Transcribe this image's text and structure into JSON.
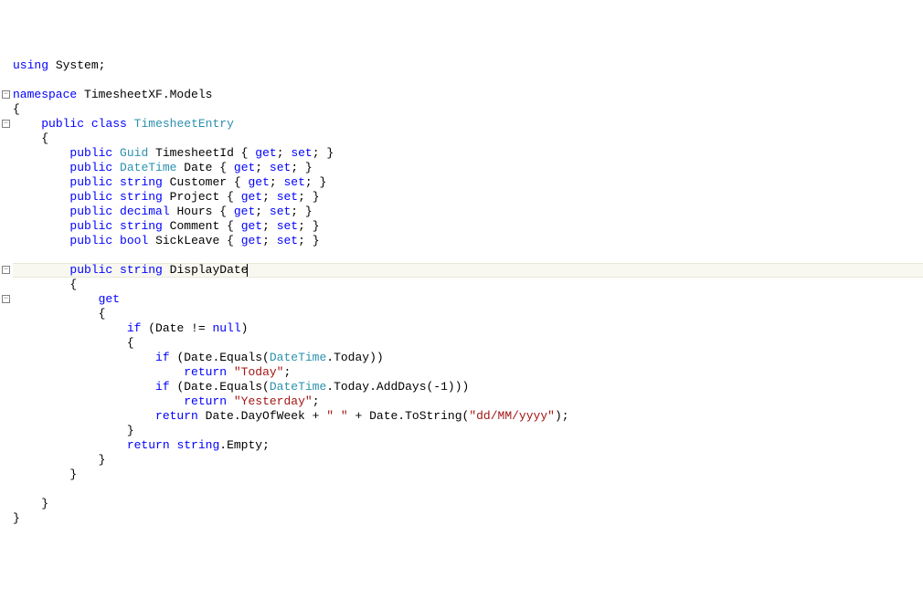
{
  "lines": [
    {
      "html": "<span class='kw'>using</span> System;"
    },
    {
      "html": ""
    },
    {
      "fold": true,
      "html": "<span class='kw'>namespace</span> TimesheetXF.Models"
    },
    {
      "html": "{"
    },
    {
      "fold": true,
      "html": "    <span class='kw'>public</span> <span class='kw'>class</span> <span class='type'>TimesheetEntry</span>"
    },
    {
      "html": "    {"
    },
    {
      "html": "        <span class='kw'>public</span> <span class='type'>Guid</span> TimesheetId { <span class='kw'>get</span>; <span class='kw'>set</span>; }"
    },
    {
      "html": "        <span class='kw'>public</span> <span class='type'>DateTime</span> Date { <span class='kw'>get</span>; <span class='kw'>set</span>; }"
    },
    {
      "html": "        <span class='kw'>public</span> <span class='kw'>string</span> Customer { <span class='kw'>get</span>; <span class='kw'>set</span>; }"
    },
    {
      "html": "        <span class='kw'>public</span> <span class='kw'>string</span> Project { <span class='kw'>get</span>; <span class='kw'>set</span>; }"
    },
    {
      "html": "        <span class='kw'>public</span> <span class='kw'>decimal</span> Hours { <span class='kw'>get</span>; <span class='kw'>set</span>; }"
    },
    {
      "html": "        <span class='kw'>public</span> <span class='kw'>string</span> Comment { <span class='kw'>get</span>; <span class='kw'>set</span>; }"
    },
    {
      "html": "        <span class='kw'>public</span> <span class='kw'>bool</span> SickLeave { <span class='kw'>get</span>; <span class='kw'>set</span>; }"
    },
    {
      "html": ""
    },
    {
      "fold": true,
      "cursor": true,
      "html": "        <span class='kw'>public</span> <span class='kw'>string</span> DisplayDate"
    },
    {
      "html": "        {"
    },
    {
      "fold": true,
      "html": "            <span class='kw'>get</span>"
    },
    {
      "html": "            {"
    },
    {
      "html": "                <span class='kw'>if</span> (Date != <span class='kw'>null</span>)"
    },
    {
      "html": "                {"
    },
    {
      "html": "                    <span class='kw'>if</span> (Date.Equals(<span class='type'>DateTime</span>.Today))"
    },
    {
      "html": "                        <span class='kw'>return</span> <span class='str'>\"Today\"</span>;"
    },
    {
      "html": "                    <span class='kw'>if</span> (Date.Equals(<span class='type'>DateTime</span>.Today.AddDays(-1)))"
    },
    {
      "html": "                        <span class='kw'>return</span> <span class='str'>\"Yesterday\"</span>;"
    },
    {
      "html": "                    <span class='kw'>return</span> Date.DayOfWeek + <span class='str'>\" \"</span> + Date.ToString(<span class='str'>\"dd/MM/yyyy\"</span>);"
    },
    {
      "html": "                }"
    },
    {
      "html": "                <span class='kw'>return</span> <span class='kw'>string</span>.Empty;"
    },
    {
      "html": "            }"
    },
    {
      "html": "        }"
    },
    {
      "html": ""
    },
    {
      "html": "    }"
    },
    {
      "html": "}"
    }
  ],
  "fold_glyph": "−"
}
